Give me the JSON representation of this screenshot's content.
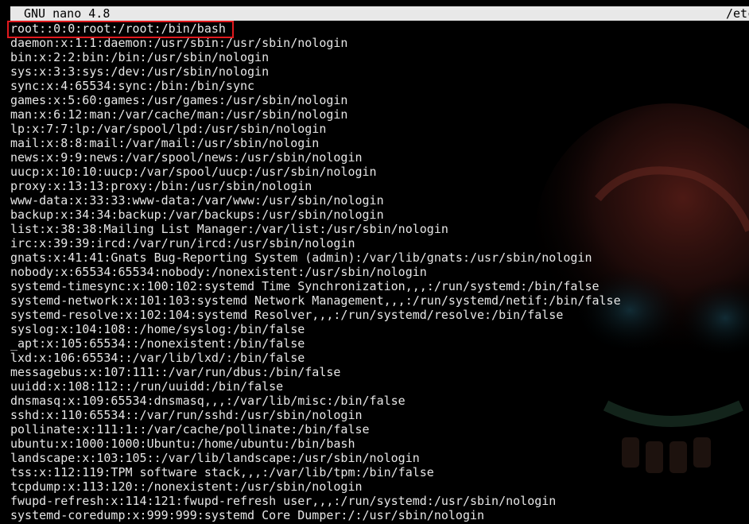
{
  "titlebar": {
    "app_name": "GNU nano 4.8",
    "file_path": "/etc"
  },
  "colors": {
    "background": "#000000",
    "text": "#e6e6e6",
    "titlebar_bg": "#e8e8e8",
    "highlight": "#e0191d"
  },
  "editor": {
    "lines": [
      "root::0:0:root:/root:/bin/bash",
      "daemon:x:1:1:daemon:/usr/sbin:/usr/sbin/nologin",
      "bin:x:2:2:bin:/bin:/usr/sbin/nologin",
      "sys:x:3:3:sys:/dev:/usr/sbin/nologin",
      "sync:x:4:65534:sync:/bin:/bin/sync",
      "games:x:5:60:games:/usr/games:/usr/sbin/nologin",
      "man:x:6:12:man:/var/cache/man:/usr/sbin/nologin",
      "lp:x:7:7:lp:/var/spool/lpd:/usr/sbin/nologin",
      "mail:x:8:8:mail:/var/mail:/usr/sbin/nologin",
      "news:x:9:9:news:/var/spool/news:/usr/sbin/nologin",
      "uucp:x:10:10:uucp:/var/spool/uucp:/usr/sbin/nologin",
      "proxy:x:13:13:proxy:/bin:/usr/sbin/nologin",
      "www-data:x:33:33:www-data:/var/www:/usr/sbin/nologin",
      "backup:x:34:34:backup:/var/backups:/usr/sbin/nologin",
      "list:x:38:38:Mailing List Manager:/var/list:/usr/sbin/nologin",
      "irc:x:39:39:ircd:/var/run/ircd:/usr/sbin/nologin",
      "gnats:x:41:41:Gnats Bug-Reporting System (admin):/var/lib/gnats:/usr/sbin/nologin",
      "nobody:x:65534:65534:nobody:/nonexistent:/usr/sbin/nologin",
      "systemd-timesync:x:100:102:systemd Time Synchronization,,,:/run/systemd:/bin/false",
      "systemd-network:x:101:103:systemd Network Management,,,:/run/systemd/netif:/bin/false",
      "systemd-resolve:x:102:104:systemd Resolver,,,:/run/systemd/resolve:/bin/false",
      "syslog:x:104:108::/home/syslog:/bin/false",
      "_apt:x:105:65534::/nonexistent:/bin/false",
      "lxd:x:106:65534::/var/lib/lxd/:/bin/false",
      "messagebus:x:107:111::/var/run/dbus:/bin/false",
      "uuidd:x:108:112::/run/uuidd:/bin/false",
      "dnsmasq:x:109:65534:dnsmasq,,,:/var/lib/misc:/bin/false",
      "sshd:x:110:65534::/var/run/sshd:/usr/sbin/nologin",
      "pollinate:x:111:1::/var/cache/pollinate:/bin/false",
      "ubuntu:x:1000:1000:Ubuntu:/home/ubuntu:/bin/bash",
      "landscape:x:103:105::/var/lib/landscape:/usr/sbin/nologin",
      "tss:x:112:119:TPM software stack,,,:/var/lib/tpm:/bin/false",
      "tcpdump:x:113:120::/nonexistent:/usr/sbin/nologin",
      "fwupd-refresh:x:114:121:fwupd-refresh user,,,:/run/systemd:/usr/sbin/nologin",
      "systemd-coredump:x:999:999:systemd Core Dumper:/:/usr/sbin/nologin"
    ]
  }
}
